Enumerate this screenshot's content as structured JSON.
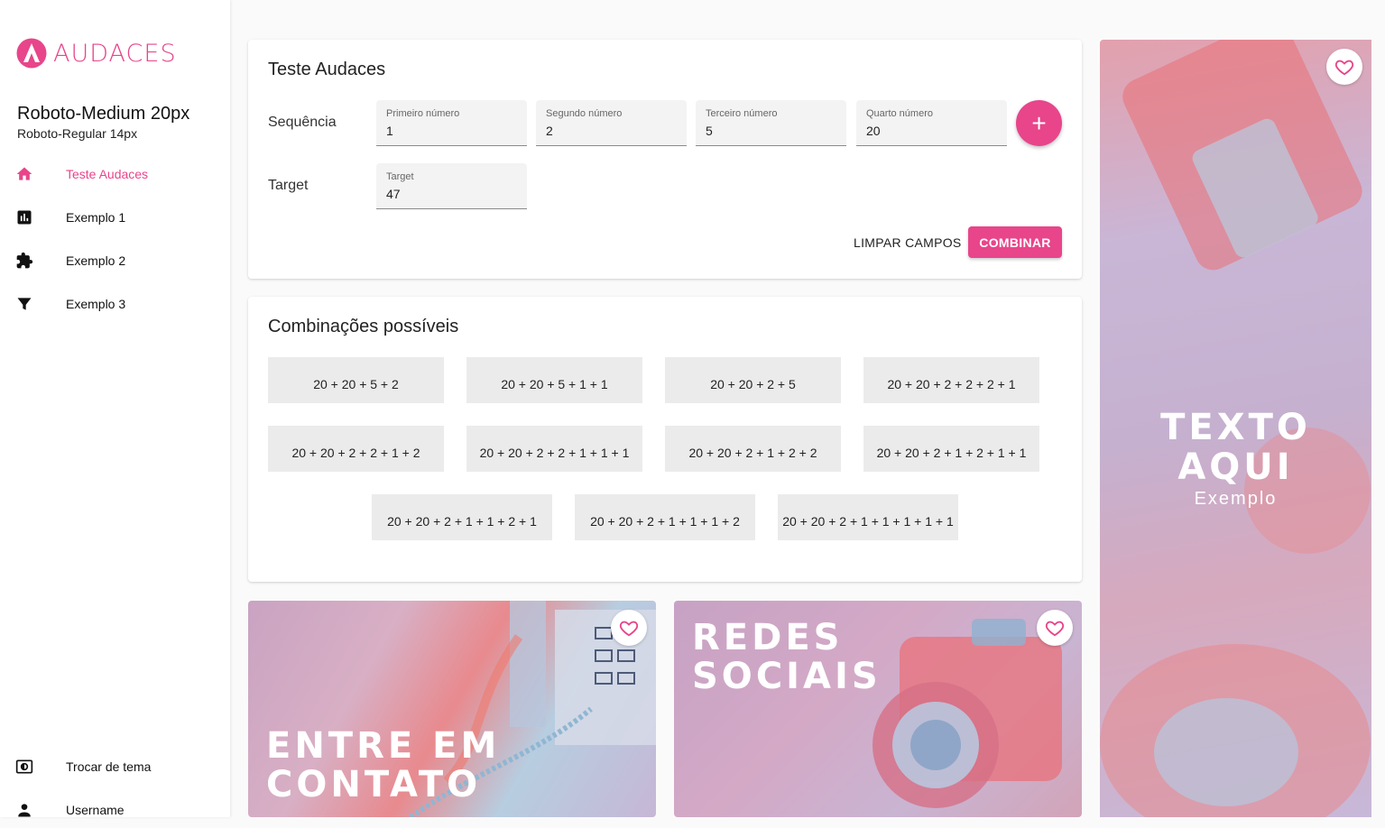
{
  "brand": {
    "logo_text": "AUDACES",
    "accent": "#e8458b"
  },
  "sidebar": {
    "title": "Roboto-Medium 20px",
    "subtitle": "Roboto-Regular 14px",
    "items": [
      {
        "label": "Teste Audaces",
        "icon": "home-icon"
      },
      {
        "label": "Exemplo 1",
        "icon": "bar-chart-icon"
      },
      {
        "label": "Exemplo 2",
        "icon": "puzzle-icon"
      },
      {
        "label": "Exemplo 3",
        "icon": "filter-icon"
      }
    ],
    "bottom": [
      {
        "label": "Trocar de tema",
        "icon": "theme-toggle-icon"
      },
      {
        "label": "Username",
        "icon": "person-icon"
      }
    ]
  },
  "form": {
    "title": "Teste Audaces",
    "sequence_label": "Sequência",
    "target_label": "Target",
    "fields": [
      {
        "label": "Primeiro número",
        "value": "1"
      },
      {
        "label": "Segundo número",
        "value": "2"
      },
      {
        "label": "Terceiro número",
        "value": "5"
      },
      {
        "label": "Quarto número",
        "value": "20"
      }
    ],
    "add_label": "+",
    "target": {
      "label": "Target",
      "value": "47"
    },
    "clear_label": "LIMPAR CAMPOS",
    "combine_label": "COMBINAR"
  },
  "results": {
    "title": "Combinações possíveis",
    "items": [
      "20 + 20 + 5 + 2",
      "20 + 20 + 5 + 1 + 1",
      "20 + 20 + 2 + 5",
      "20 + 20 + 2 + 2 + 2 + 1",
      "20 + 20 + 2 + 2 + 1 + 2",
      "20 + 20 + 2 + 2 + 1 + 1 + 1",
      "20 + 20 + 2 + 1 + 2 + 2",
      "20 + 20 + 2 + 1 + 2 + 1 + 1",
      "20 + 20 + 2 + 1 + 1 + 2 + 1",
      "20 + 20 + 2 + 1 + 1 + 1 + 2",
      "20 + 20 + 2 + 1 + 1 + 1 + 1 + 1"
    ]
  },
  "tiles": {
    "contact": {
      "line1": "ENTRE EM",
      "line2": "CONTATO"
    },
    "social": {
      "line1": "REDES",
      "line2": "SOCIAIS"
    },
    "side": {
      "line1": "TEXTO",
      "line2": "AQUI",
      "sub": "Exemplo"
    }
  }
}
